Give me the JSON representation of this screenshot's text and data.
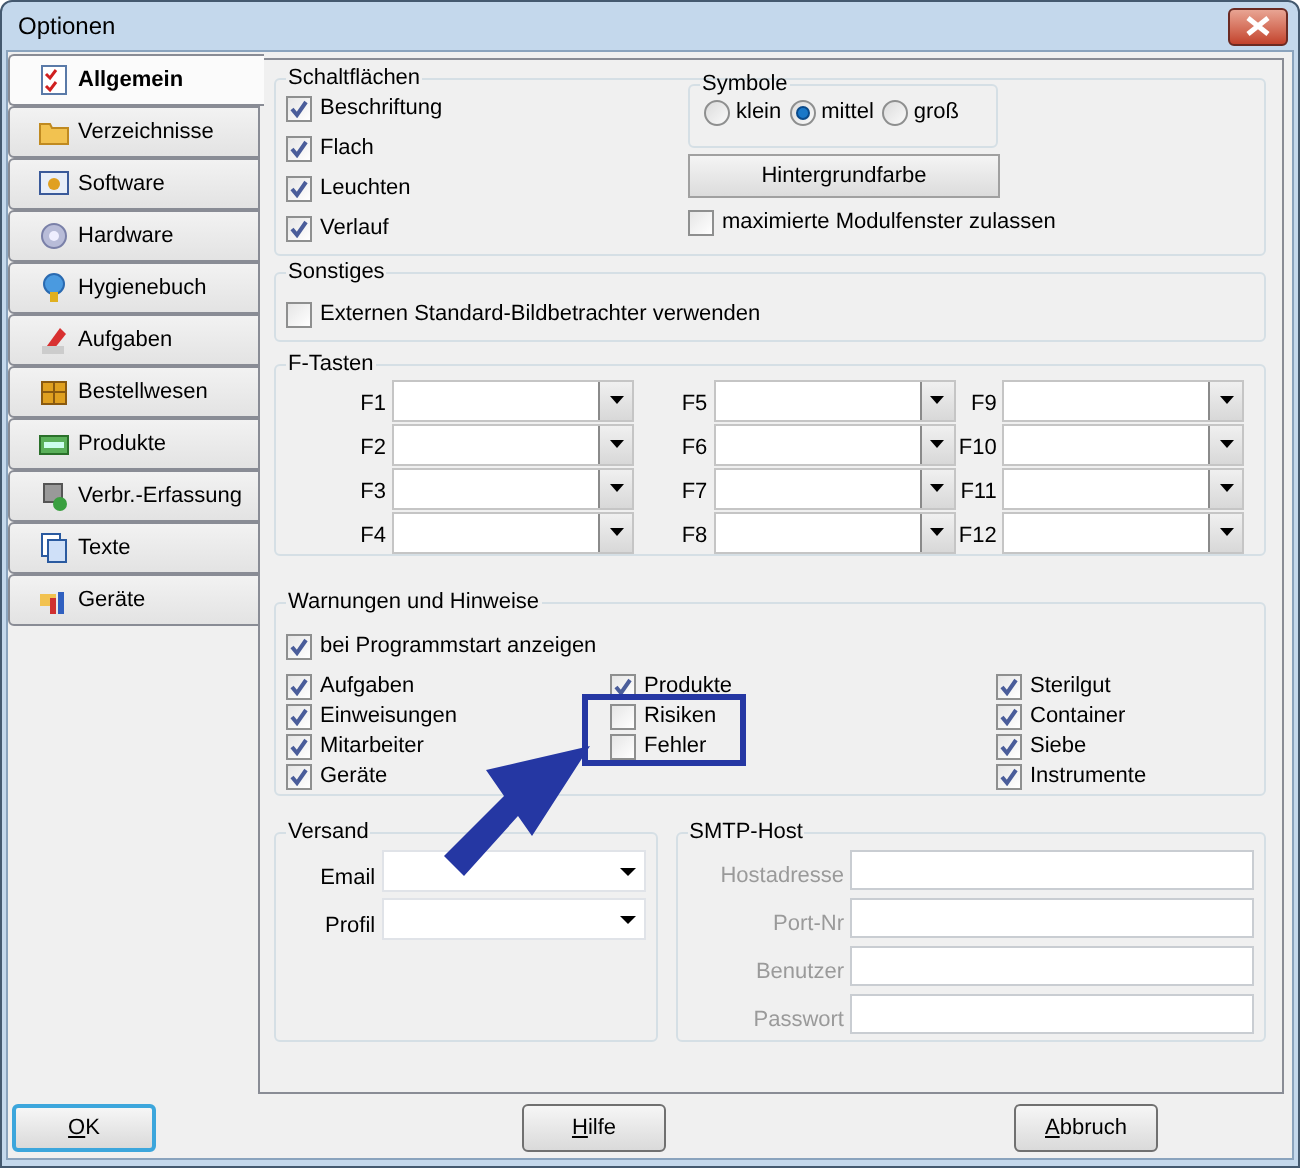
{
  "window": {
    "title": "Optionen"
  },
  "tabs": [
    {
      "label": "Allgemein",
      "selected": true
    },
    {
      "label": "Verzeichnisse",
      "selected": false
    },
    {
      "label": "Software",
      "selected": false
    },
    {
      "label": "Hardware",
      "selected": false
    },
    {
      "label": "Hygienebuch",
      "selected": false
    },
    {
      "label": "Aufgaben",
      "selected": false
    },
    {
      "label": "Bestellwesen",
      "selected": false
    },
    {
      "label": "Produkte",
      "selected": false
    },
    {
      "label": "Verbr.-Erfassung",
      "selected": false
    },
    {
      "label": "Texte",
      "selected": false
    },
    {
      "label": "Geräte",
      "selected": false
    }
  ],
  "schaltflaechen": {
    "title": "Schaltflächen",
    "options": [
      {
        "label": "Beschriftung",
        "checked": true
      },
      {
        "label": "Flach",
        "checked": true
      },
      {
        "label": "Leuchten",
        "checked": true
      },
      {
        "label": "Verlauf",
        "checked": true
      }
    ],
    "symbole": {
      "title": "Symbole",
      "options": [
        {
          "label": "klein",
          "selected": false
        },
        {
          "label": "mittel",
          "selected": true
        },
        {
          "label": "groß",
          "selected": false
        }
      ]
    },
    "button": "Hintergrundfarbe",
    "option": {
      "label": "maximierte Modulfenster zulassen",
      "checked": false
    }
  },
  "sonstiges": {
    "title": "Sonstiges",
    "options": [
      {
        "label": "Externen Standard-Bildbetrachter verwenden",
        "checked": false
      }
    ]
  },
  "f_tasten": {
    "title": "F-Tasten",
    "keys": [
      {
        "label": "F1"
      },
      {
        "label": "F2"
      },
      {
        "label": "F3"
      },
      {
        "label": "F4"
      },
      {
        "label": "F5"
      },
      {
        "label": "F6"
      },
      {
        "label": "F7"
      },
      {
        "label": "F8"
      },
      {
        "label": "F9"
      },
      {
        "label": "F10"
      },
      {
        "label": "F11"
      },
      {
        "label": "F12"
      }
    ]
  },
  "warnungen": {
    "title": "Warnungen und Hinweise",
    "option": {
      "label": "bei Programmstart anzeigen",
      "checked": true
    },
    "columns": [
      {
        "items": [
          {
            "label": "Aufgaben",
            "checked": true
          },
          {
            "label": "Einweisungen",
            "checked": true
          },
          {
            "label": "Mitarbeiter",
            "checked": true
          },
          {
            "label": "Geräte",
            "checked": true
          }
        ]
      },
      {
        "items": [
          {
            "label": "Produkte",
            "checked": true
          },
          {
            "label": "Risiken",
            "checked": false
          },
          {
            "label": "Fehler",
            "checked": false
          }
        ]
      },
      {
        "items": [
          {
            "label": "Sterilgut",
            "checked": true
          },
          {
            "label": "Container",
            "checked": true
          },
          {
            "label": "Siebe",
            "checked": true
          },
          {
            "label": "Instrumente",
            "checked": true
          }
        ]
      }
    ]
  },
  "versand": {
    "title": "Versand",
    "fields": [
      {
        "label": "Email"
      },
      {
        "label": "Profil"
      }
    ]
  },
  "smtp_host": {
    "title": "SMTP-Host",
    "disabled": true,
    "fields": [
      {
        "label": "Hostadresse"
      },
      {
        "label": "Port-Nr"
      },
      {
        "label": "Benutzer"
      },
      {
        "label": "Passwort"
      }
    ]
  },
  "buttons": [
    {
      "label": "OK",
      "focused": true
    },
    {
      "label": "Hilfe",
      "focused": false
    },
    {
      "label": "Abbruch",
      "focused": false
    }
  ]
}
